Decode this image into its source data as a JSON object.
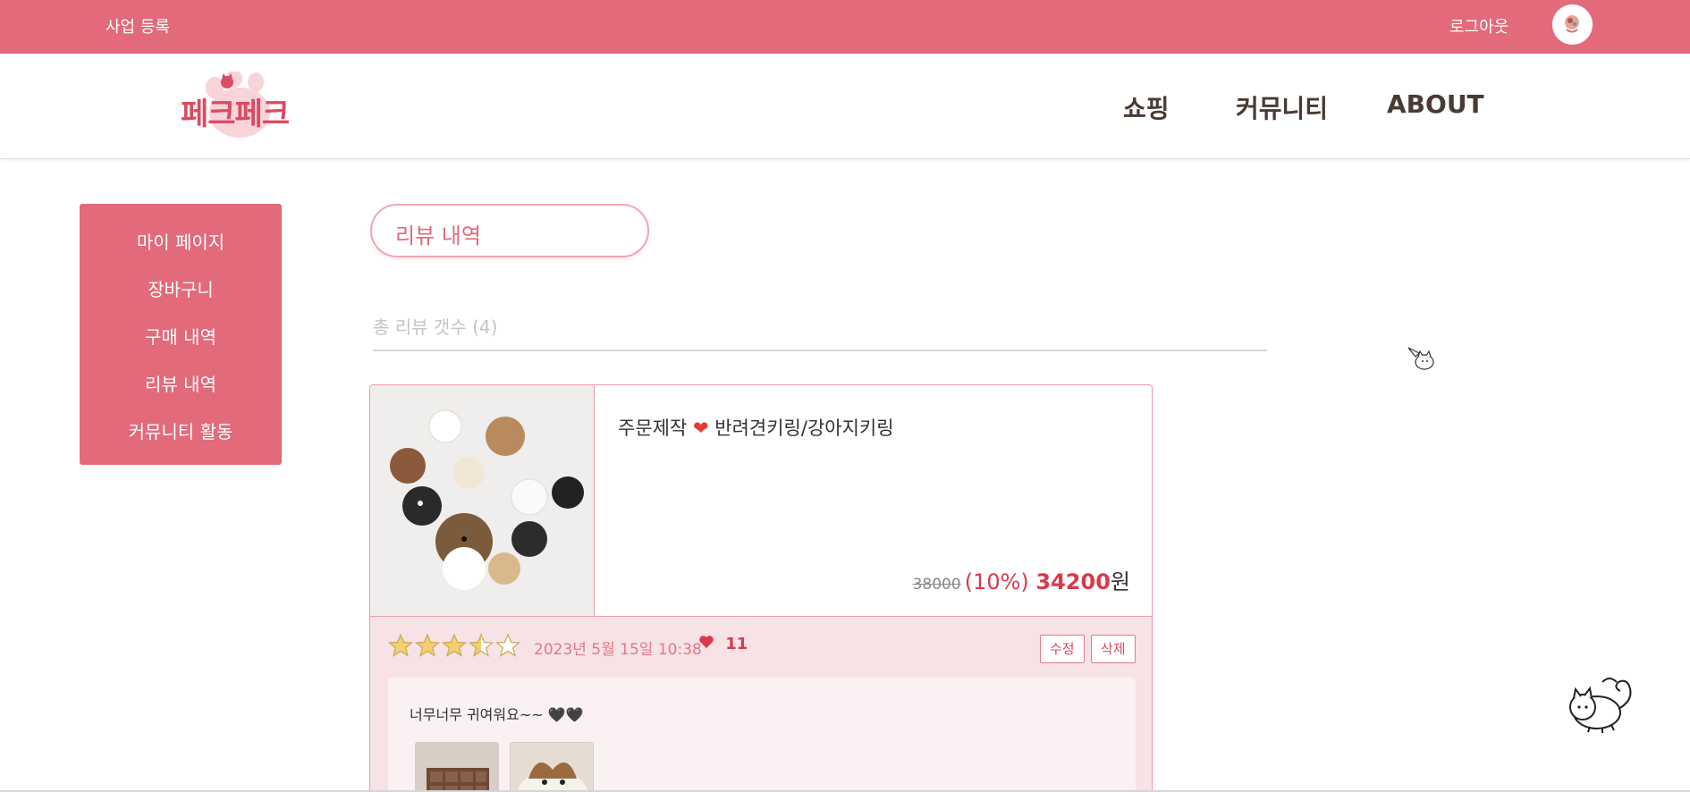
{
  "topbar": {
    "business_register": "사업 등록",
    "logout": "로그아웃",
    "avatar_icon": "avatar-icon"
  },
  "header": {
    "logo_text": "페크페크",
    "nav": [
      "쇼핑",
      "커뮤니티",
      "ABOUT"
    ]
  },
  "sidebar": {
    "items": [
      "마이 페이지",
      "장바구니",
      "구매 내역",
      "리뷰 내역",
      "커뮤니티 활동"
    ]
  },
  "main": {
    "title": "리뷰 내역",
    "count_label": "총 리뷰 갯수 (4)"
  },
  "review_card": {
    "product_name_prefix": "주문제작",
    "product_name_heart": "❤",
    "product_name_suffix": "반려견키링/강아지키링",
    "price_original": "38000",
    "price_discount": "(10%)",
    "price_final": "34200",
    "price_currency": "원",
    "rating": 3.5,
    "rating_max": 5,
    "date": "2023년 5월 15일 10:38",
    "likes": "11",
    "edit_label": "수정",
    "delete_label": "삭제",
    "review_text": "너무너무 귀여워요~~ 🖤🖤"
  },
  "colors": {
    "brand_pink": "#e26a7a",
    "accent_red": "#d83a4d",
    "review_bg": "#f7e2e5"
  }
}
